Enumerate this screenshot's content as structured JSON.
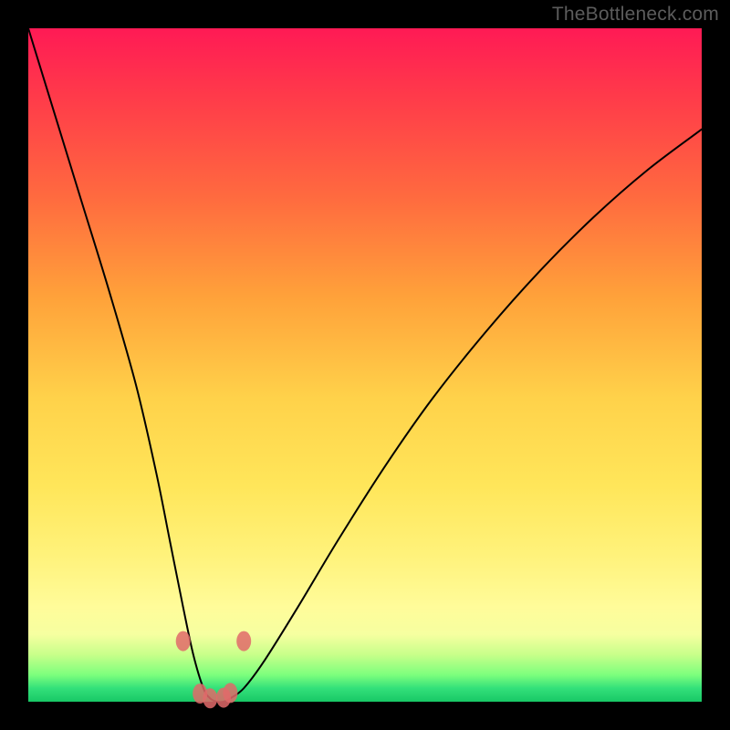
{
  "watermark": "TheBottleneck.com",
  "colors": {
    "frame": "#000000",
    "gradient_top": "#ff1a55",
    "gradient_mid": "#ffe65a",
    "gradient_bottom": "#18c866",
    "curve": "#000000",
    "marker": "#e06a6a"
  },
  "chart_data": {
    "type": "line",
    "title": "",
    "xlabel": "",
    "ylabel": "",
    "xlim": [
      0,
      100
    ],
    "ylim": [
      0,
      100
    ],
    "x": [
      0,
      4,
      8,
      12,
      16,
      19,
      21,
      23,
      24.5,
      26,
      27,
      28,
      29,
      30,
      32,
      35,
      40,
      46,
      53,
      60,
      68,
      76,
      84,
      92,
      100
    ],
    "values": [
      100,
      87,
      74,
      61,
      47,
      34,
      24,
      14,
      7,
      2,
      0.5,
      0,
      0,
      0.5,
      2,
      6,
      14,
      24,
      35,
      45,
      55,
      64,
      72,
      79,
      85
    ],
    "markers": [
      {
        "x": 23.0,
        "y": 9.0
      },
      {
        "x": 25.5,
        "y": 1.2
      },
      {
        "x": 27.0,
        "y": 0.5
      },
      {
        "x": 29.0,
        "y": 0.6
      },
      {
        "x": 30.0,
        "y": 1.3
      },
      {
        "x": 32.0,
        "y": 9.0
      }
    ],
    "annotations": []
  }
}
